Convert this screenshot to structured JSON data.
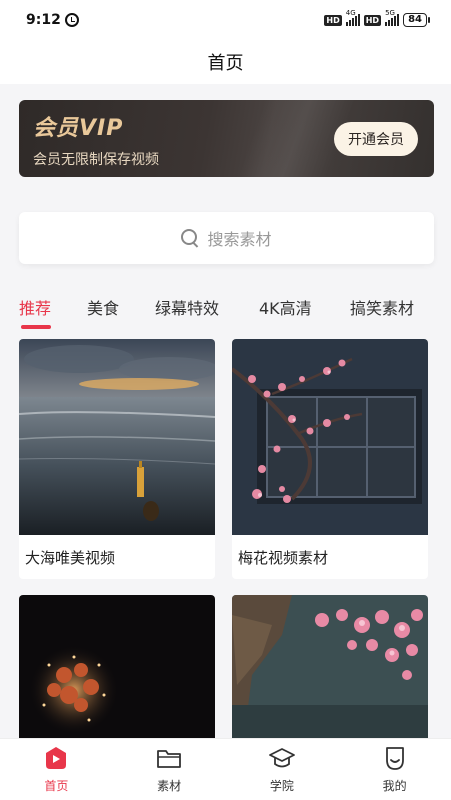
{
  "status_bar": {
    "time": "9:12",
    "hd1": "HD",
    "net1": "4G",
    "hd2": "HD",
    "net2": "5G",
    "battery": "84"
  },
  "header": {
    "title": "首页"
  },
  "vip": {
    "title": "会员VIP",
    "subtitle": "会员无限制保存视频",
    "button_label": "开通会员"
  },
  "search": {
    "placeholder": "搜索素材"
  },
  "tabs": [
    {
      "label": "推荐",
      "active": true
    },
    {
      "label": "美食",
      "active": false
    },
    {
      "label": "绿幕特效",
      "active": false
    },
    {
      "label": "4K高清",
      "active": false
    },
    {
      "label": "搞笑素材",
      "active": false
    }
  ],
  "cards": [
    {
      "caption": "大海唯美视频"
    },
    {
      "caption": "梅花视频素材"
    }
  ],
  "tab_bar": [
    {
      "label": "首页",
      "icon": "home-play-icon",
      "active": true
    },
    {
      "label": "素材",
      "icon": "folder-icon",
      "active": false
    },
    {
      "label": "学院",
      "icon": "graduation-cap-icon",
      "active": false
    },
    {
      "label": "我的",
      "icon": "profile-icon",
      "active": false
    }
  ],
  "colors": {
    "accent": "#e8364a",
    "vip_gold": "#e9c89a",
    "vip_bg": "#2f2a28"
  }
}
